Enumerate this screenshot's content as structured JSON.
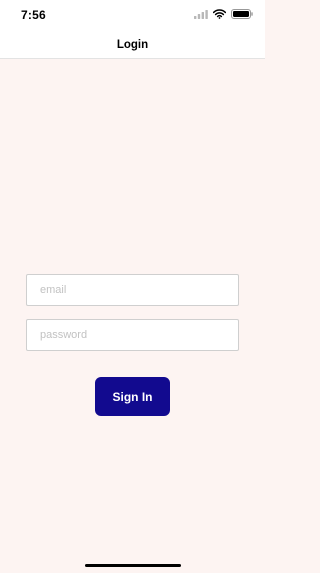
{
  "status_bar": {
    "time": "7:56",
    "icons": [
      "signal-icon",
      "wifi-icon",
      "battery-icon"
    ]
  },
  "nav": {
    "title": "Login"
  },
  "form": {
    "email": {
      "value": "",
      "placeholder": "email"
    },
    "password": {
      "value": "",
      "placeholder": "password"
    },
    "sign_in_label": "Sign In"
  },
  "colors": {
    "background": "#fdf4f2",
    "accent": "#120a8f",
    "bar_background": "#ffffff"
  }
}
